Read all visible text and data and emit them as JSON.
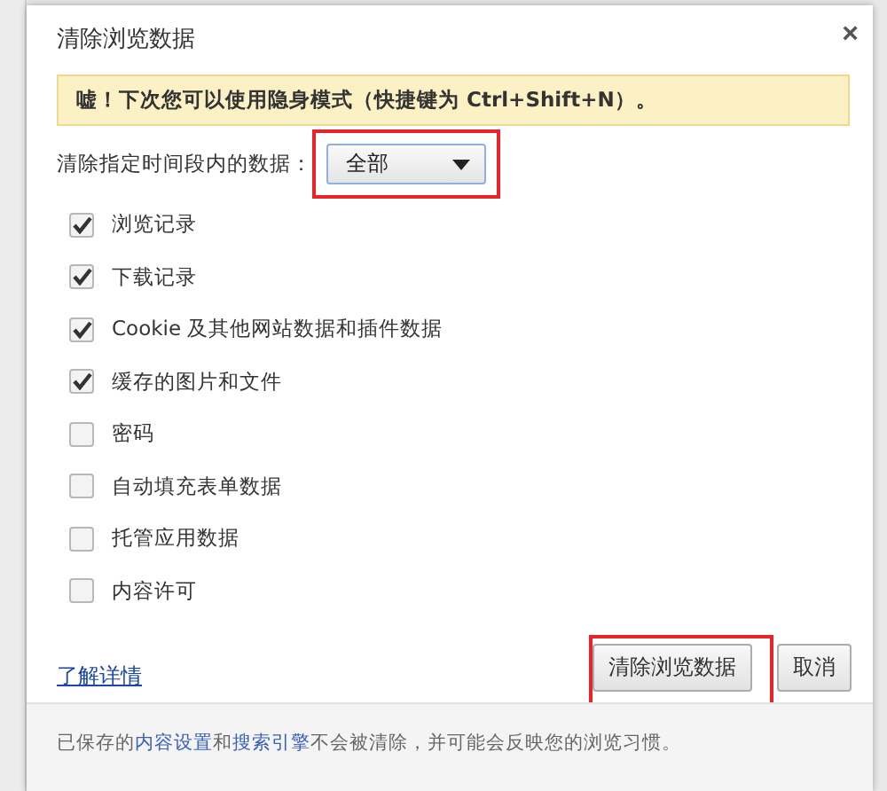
{
  "dialog": {
    "title": "清除浏览数据",
    "close": "×",
    "banner": "嘘！下次您可以使用隐身模式（快捷键为 Ctrl+Shift+N）。",
    "range": {
      "label": "清除指定时间段内的数据：",
      "value": "全部",
      "highlighted": true
    },
    "options": [
      {
        "label": "浏览记录",
        "checked": true
      },
      {
        "label": "下载记录",
        "checked": true
      },
      {
        "label": "Cookie 及其他网站数据和插件数据",
        "checked": true
      },
      {
        "label": "缓存的图片和文件",
        "checked": true
      },
      {
        "label": "密码",
        "checked": false
      },
      {
        "label": "自动填充表单数据",
        "checked": false
      },
      {
        "label": "托管应用数据",
        "checked": false
      },
      {
        "label": "内容许可",
        "checked": false
      }
    ],
    "learn_more": "了解详情",
    "buttons": [
      {
        "label": "清除浏览数据",
        "highlighted": true
      },
      {
        "label": "取消",
        "highlighted": false
      }
    ],
    "footer": {
      "before": "已保存的",
      "link1": "内容设置",
      "middle": "和",
      "link2": "搜索引擎",
      "after": "不会被清除，并可能会反映您的浏览习惯。"
    }
  }
}
